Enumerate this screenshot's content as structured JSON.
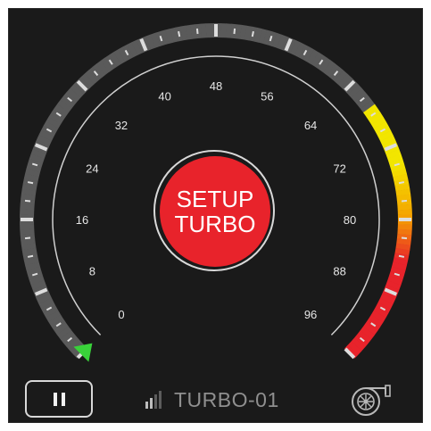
{
  "gauge": {
    "scale_labels": [
      "0",
      "8",
      "16",
      "24",
      "32",
      "40",
      "48",
      "56",
      "64",
      "72",
      "80",
      "88",
      "96"
    ],
    "current_value": 0,
    "colors": {
      "background": "#1a1a1a",
      "tick_track": "#5a5a5a",
      "tick_mark": "#dddddd",
      "warning_start": "#f2e600",
      "warning_mid": "#f5a300",
      "danger": "#e8232b",
      "needle": "#39d23a",
      "label": "#e6e6e6"
    }
  },
  "setup_button": {
    "label": "SETUP\nTURBO",
    "color": "#e8232b"
  },
  "bottom_bar": {
    "pause_icon": "pause-icon",
    "signal_icon": "signal-icon",
    "device_name": "TURBO-01",
    "turbo_icon": "turbo-icon"
  }
}
